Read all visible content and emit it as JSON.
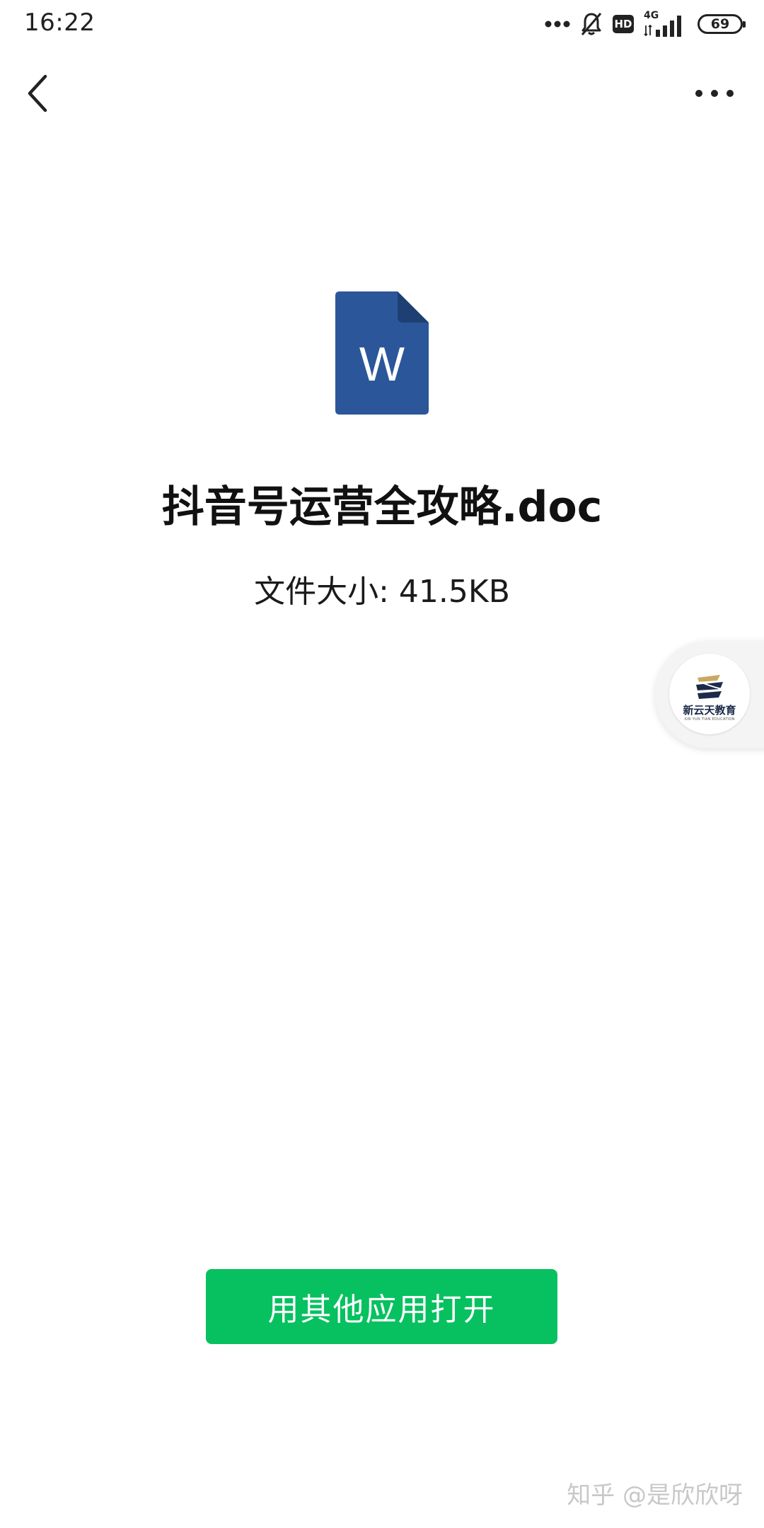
{
  "status_bar": {
    "time": "16:22",
    "network": "4G",
    "battery": "69"
  },
  "file": {
    "icon_letter": "W",
    "name": "抖音号运营全攻略.doc",
    "size": "文件大小: 41.5KB"
  },
  "floating_bubble": {
    "brand": "新云天教育",
    "brand_sub": "XIN YUN TIAN EDUCATION"
  },
  "actions": {
    "open_with_other_app": "用其他应用打开"
  },
  "watermark": "知乎 @是欣欣呀",
  "colors": {
    "accent_green": "#07c160",
    "word_blue": "#2b579a",
    "word_blue_dark": "#1e3f73"
  }
}
